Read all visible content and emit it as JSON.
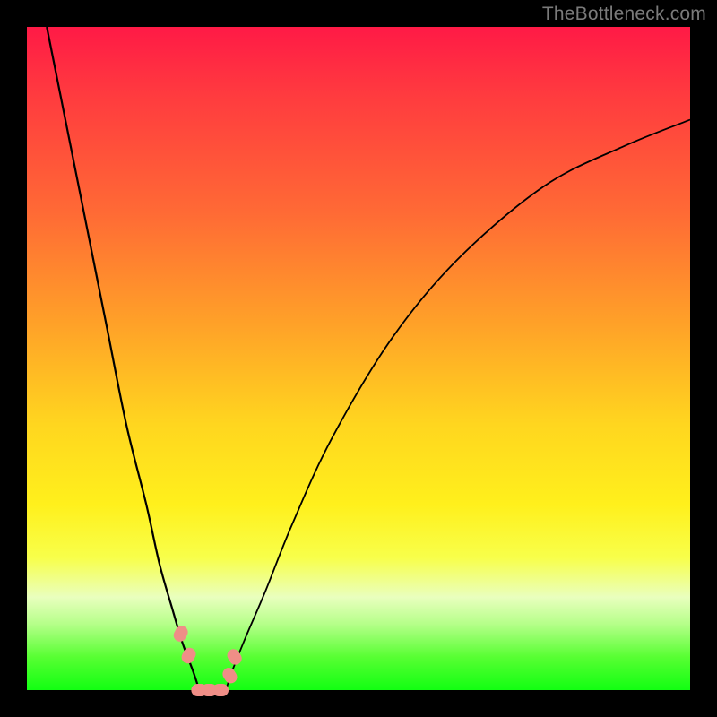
{
  "watermark": "TheBottleneck.com",
  "chart_data": {
    "type": "line",
    "title": "",
    "xlabel": "",
    "ylabel": "",
    "xlim": [
      0,
      100
    ],
    "ylim": [
      0,
      100
    ],
    "series": [
      {
        "name": "left-branch",
        "x": [
          3,
          5,
          8,
          12,
          15,
          18,
          20,
          22,
          23.5,
          25,
          26
        ],
        "y": [
          100,
          90,
          75,
          55,
          40,
          28,
          19,
          12,
          7,
          3,
          0
        ]
      },
      {
        "name": "right-branch",
        "x": [
          30,
          31,
          33,
          36,
          40,
          46,
          55,
          65,
          78,
          90,
          100
        ],
        "y": [
          0,
          3,
          8,
          15,
          25,
          38,
          53,
          65,
          76,
          82,
          86
        ]
      },
      {
        "name": "valley-floor",
        "x": [
          26,
          27,
          28,
          29,
          30
        ],
        "y": [
          0,
          0,
          0,
          0,
          0
        ]
      }
    ],
    "markers": [
      {
        "name": "left-dip-marker-upper",
        "x": 23.2,
        "y": 8.5
      },
      {
        "name": "left-dip-marker-lower",
        "x": 24.4,
        "y": 5.2
      },
      {
        "name": "right-dip-marker-upper",
        "x": 31.3,
        "y": 5.0
      },
      {
        "name": "right-dip-marker-lower",
        "x": 30.6,
        "y": 2.2
      },
      {
        "name": "valley-floor-blob-a",
        "x": 26.0,
        "y": 0.0
      },
      {
        "name": "valley-floor-blob-b",
        "x": 27.5,
        "y": 0.0
      },
      {
        "name": "valley-floor-blob-c",
        "x": 29.2,
        "y": 0.0
      }
    ],
    "colors": {
      "curve": "#000000",
      "marker": "#ef8e87",
      "gradient_top": "#ff1a46",
      "gradient_mid": "#ffd61f",
      "gradient_bottom": "#12ff12",
      "frame": "#000000"
    }
  }
}
